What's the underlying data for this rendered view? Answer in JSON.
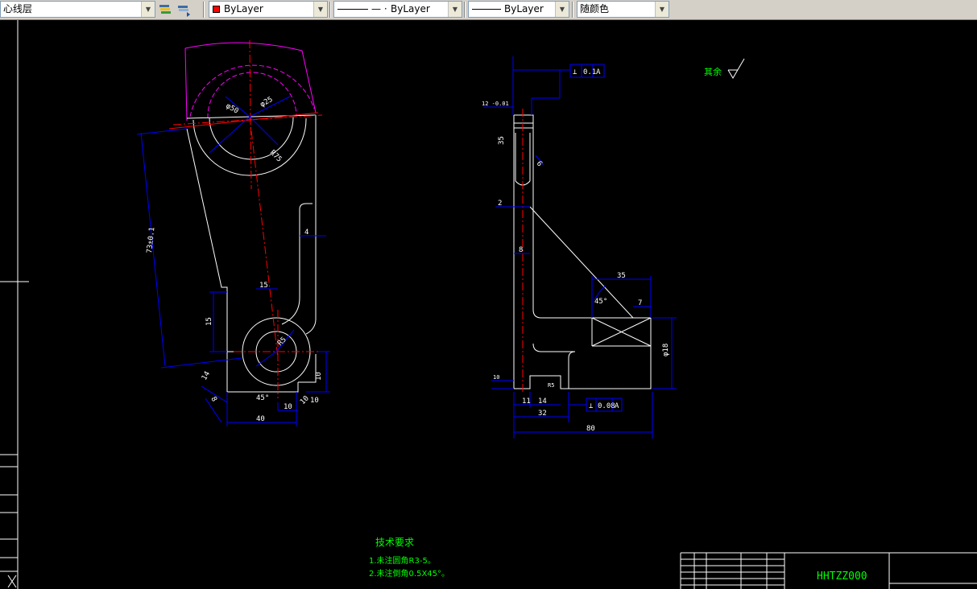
{
  "toolbar": {
    "layer_combo": {
      "value": "心线层"
    },
    "color_combo": {
      "value": "ByLayer",
      "swatch": "#ff0000"
    },
    "linetype_combo": {
      "value": "ByLayer"
    },
    "lineweight_combo": {
      "value": "ByLayer"
    },
    "plotstyle_combo": {
      "value": "随颜色"
    },
    "icons": [
      "layer-states-icon",
      "layer-previous-icon"
    ]
  },
  "drawing": {
    "background": "#000000",
    "colors": {
      "outline": "#ffffff",
      "dimension": "#0000ff",
      "center": "#ff0000",
      "phantom": "#ff00ff",
      "text": "#00ff00"
    },
    "left_view_dims": {
      "d_center_distance": "73±0.1",
      "d_height": "15",
      "d_width": "40",
      "d_bottom_offset": "10",
      "d_side": "4",
      "d_boss": "15",
      "d_angle": "45°",
      "d_r_bore": "φ25",
      "d_r_big": "φ50",
      "d_r_arc": "R75",
      "d_r_small": "R5",
      "d_depth": "10",
      "d_edge": "14",
      "d_ht": "10",
      "d_bot_left": "8",
      "d_bot_side": "10"
    },
    "right_view_dims": {
      "d_top_tol": "12 -0.01",
      "d_top": "35",
      "d_depth": "6",
      "d_gap": "2",
      "d_thick": "8",
      "d_rib": "35",
      "d_angle": "45°",
      "d_small": "7",
      "d_block": "φ18",
      "d_bot1": "11",
      "d_bot2": "14",
      "d_bot3": "32",
      "d_total": "80",
      "d_bot_h": "10",
      "d_bot_rad": "R5",
      "tol_frame_top": [
        "⊥",
        "0.1",
        "A"
      ],
      "tol_frame_bot": [
        "⊥",
        "0.08",
        "A"
      ]
    },
    "surface_finish_note": "其余",
    "tech_requirements": {
      "title": "技术要求",
      "items": [
        "1.未注圆角R3-5。",
        "2.未注倒角0.5X45°。"
      ]
    },
    "title_block": {
      "drawing_no": "HHTZZ000"
    }
  }
}
